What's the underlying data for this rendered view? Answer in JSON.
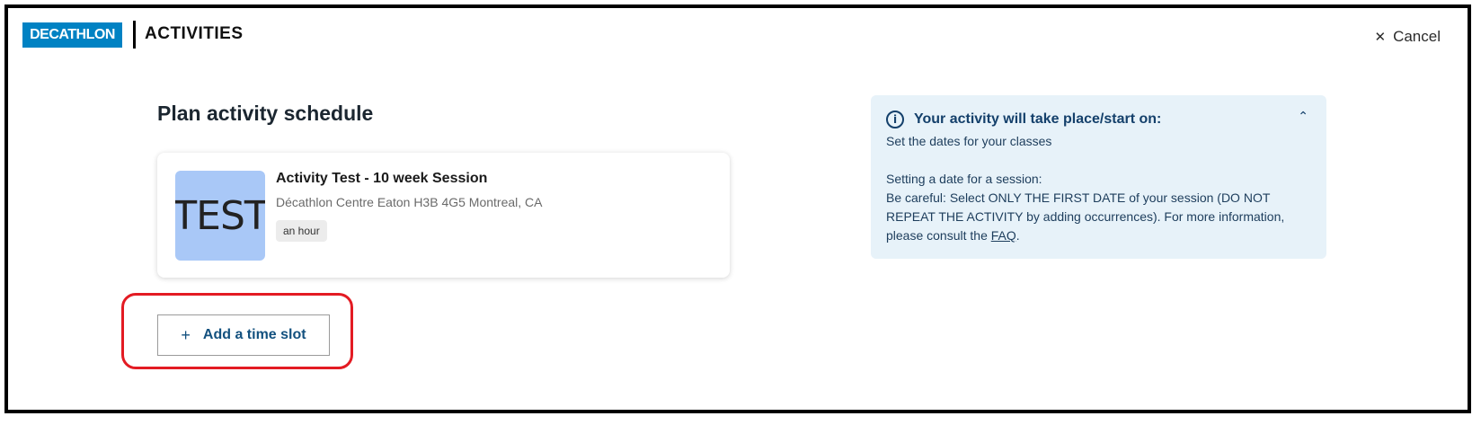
{
  "header": {
    "logo_text": "DECATHLON",
    "title": "ACTIVITIES",
    "cancel_icon": "close-icon",
    "cancel_label": "Cancel"
  },
  "main": {
    "page_title": "Plan activity schedule",
    "activity_card": {
      "thumbnail_text": "TEST",
      "title": "Activity Test - 10 week Session",
      "location": "Décathlon Centre Eaton H3B 4G5 Montreal, CA",
      "duration": "an hour"
    },
    "add_slot": {
      "icon": "plus-icon",
      "label": "Add a time slot"
    }
  },
  "info_panel": {
    "icon": "info-icon",
    "title": "Your activity will take place/start on:",
    "subtitle": "Set the dates for your classes",
    "section_heading": "Setting a date for a session:",
    "body_text": "Be careful: Select ONLY THE FIRST DATE of your session (DO NOT REPEAT THE ACTIVITY by adding occurrences). For more information, please consult the ",
    "faq_link": "FAQ",
    "trailing": "."
  },
  "colors": {
    "brand": "#0082c3",
    "accent_text": "#13517f",
    "info_bg": "#e7f2f9",
    "highlight": "#e31b23"
  }
}
